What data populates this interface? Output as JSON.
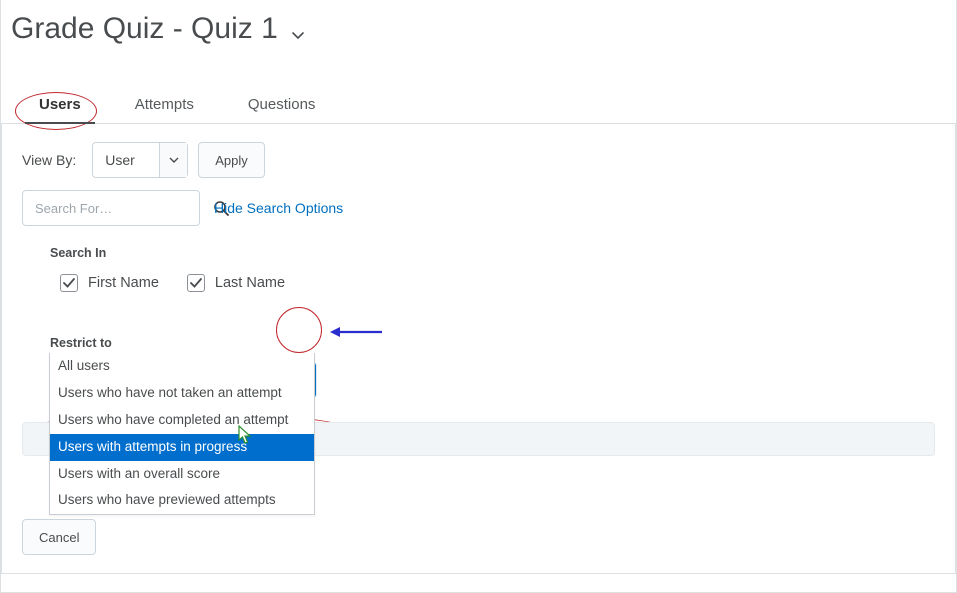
{
  "title": "Grade Quiz - Quiz 1",
  "tabs": [
    {
      "label": "Users",
      "active": true
    },
    {
      "label": "Attempts",
      "active": false
    },
    {
      "label": "Questions",
      "active": false
    }
  ],
  "viewby": {
    "label": "View By:",
    "selected": "User",
    "apply_label": "Apply"
  },
  "search": {
    "placeholder": "Search For…",
    "hide_options_label": "Hide Search Options"
  },
  "search_in": {
    "heading": "Search In",
    "opts": [
      {
        "label": "First Name",
        "checked": true
      },
      {
        "label": "Last Name",
        "checked": true
      }
    ]
  },
  "restrict": {
    "heading": "Restrict to",
    "selected": "All users",
    "options": [
      "All users",
      "Users who have not taken an attempt",
      "Users who have completed an attempt",
      "Users with attempts in progress",
      "Users with an overall score",
      "Users who have previewed attempts"
    ],
    "highlight_index": 3
  },
  "cancel_label": "Cancel"
}
